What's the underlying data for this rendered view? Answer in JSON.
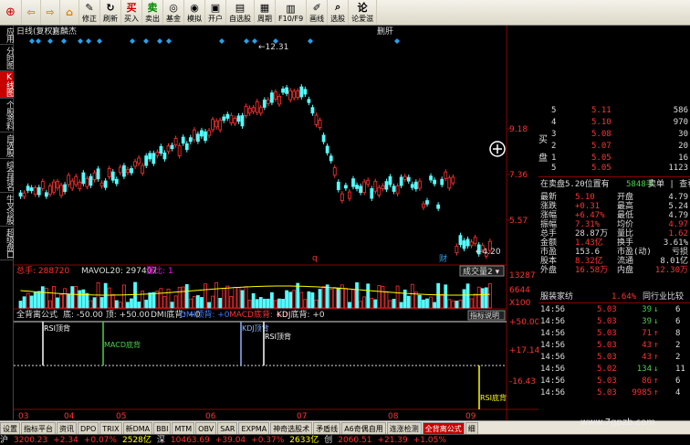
{
  "toolbar": [
    {
      "label": "",
      "icon": "back-icon"
    },
    {
      "label": "",
      "icon": "forward-icon"
    },
    {
      "label": "",
      "icon": "home-icon"
    },
    {
      "label": "修正",
      "icon": "edit-icon"
    },
    {
      "label": "刷新",
      "icon": "refresh-icon"
    },
    {
      "label": "买入",
      "icon": "buy-icon"
    },
    {
      "label": "卖出",
      "icon": "sell-icon"
    },
    {
      "label": "基金",
      "icon": "fund-icon"
    },
    {
      "label": "模拟",
      "icon": "simulate-icon"
    },
    {
      "label": "开户",
      "icon": "account-icon"
    },
    {
      "label": "自选股",
      "icon": "watchlist-icon"
    },
    {
      "label": "周期",
      "icon": "period-icon"
    },
    {
      "label": "F10/F9",
      "icon": "f10-icon"
    },
    {
      "label": "画线",
      "icon": "draw-icon"
    },
    {
      "label": "选股",
      "icon": "stock-pick-icon"
    },
    {
      "label": "论爱滋",
      "icon": "forum-icon"
    }
  ],
  "side_tabs": [
    "应用",
    "分时图",
    "K线图",
    "个股资料",
    "自选股",
    "综合排名",
    "牛叉诊股",
    "超级盘口"
  ],
  "chart": {
    "header": "日线(复权)",
    "stock_name": "嘉麟杰",
    "header_right": "删肝",
    "price_ticks": [
      "9.18",
      "7.36",
      "5.57"
    ],
    "max_label": "12.31",
    "min_label": "4.20",
    "vol_header": "总手: 288720",
    "mavol": "MAVOL20: 297407",
    "vol_ratio": "量比: 1",
    "vol_select": "成交量2",
    "vol_ticks": [
      "13287",
      "6644",
      "X100"
    ],
    "ind_header": "全背离公式",
    "ind_params": "底: -50.00  顶: +50.00",
    "ind_items": [
      "DMI底背: +0",
      "DMI顶背: +0",
      "MACD底背: +0",
      "KDJ底背: +0"
    ],
    "ind_help": "指标说明",
    "ind_ticks": [
      "+50.00",
      "+17.14",
      "-16.43"
    ],
    "signals": [
      "RSI顶背",
      "MACD底背",
      "KDJ顶背",
      "RSI顶背",
      "RSI底背"
    ],
    "months": [
      "03",
      "04",
      "05",
      "06",
      "07",
      "08",
      "09"
    ],
    "marker_q": "q",
    "marker_cai": "财"
  },
  "quote": {
    "sell": [
      {
        "label": "5",
        "price": "5.11",
        "vol": "586"
      },
      {
        "label": "4",
        "price": "5.10",
        "vol": "970"
      },
      {
        "label": "3",
        "price": "5.08",
        "vol": "30"
      },
      {
        "label": "2",
        "price": "5.07",
        "vol": "20"
      },
      {
        "label": "1",
        "price": "5.05",
        "vol": "16"
      }
    ],
    "buy_first": {
      "label": "5",
      "price": "5.05",
      "vol": "1123"
    },
    "sell_side_label": "买",
    "buy_side_label": "盘",
    "info_line": "在卖盘5.20位置有",
    "info_qty": "5848手",
    "info_link": "卖单 | 查看详细",
    "stats": [
      [
        "最新",
        "5.10",
        "开盘",
        "4.79"
      ],
      [
        "涨跌",
        "+0.31",
        "最高",
        "5.24"
      ],
      [
        "涨幅",
        "+6.47%",
        "最低",
        "4.79"
      ],
      [
        "振幅",
        "7.31%",
        "均价",
        "4.97"
      ],
      [
        "总手",
        "28.87万",
        "量比",
        "1.62"
      ],
      [
        "金额",
        "1.43亿",
        "换手",
        "3.61%"
      ],
      [
        "市盈",
        "153.6",
        "市盈(动)",
        "亏损"
      ],
      [
        "股本",
        "8.32亿",
        "流通",
        "8.01亿"
      ],
      [
        "外盘",
        "16.58万",
        "内盘",
        "12.30万"
      ]
    ],
    "industry": "服装家纺",
    "industry_pct": "1.64%",
    "industry_link": "同行业比较",
    "ticks": [
      {
        "time": "14:56",
        "price": "5.03",
        "vol": "39",
        "dir": "down",
        "n": "6"
      },
      {
        "time": "14:56",
        "price": "5.03",
        "vol": "39",
        "dir": "down",
        "n": "6"
      },
      {
        "time": "14:56",
        "price": "5.03",
        "vol": "71",
        "dir": "up",
        "n": "8"
      },
      {
        "time": "14:56",
        "price": "5.03",
        "vol": "43",
        "dir": "up",
        "n": "2"
      },
      {
        "time": "14:56",
        "price": "5.03",
        "vol": "43",
        "dir": "up",
        "n": "2"
      },
      {
        "time": "14:56",
        "price": "5.02",
        "vol": "134",
        "dir": "down",
        "n": "11"
      },
      {
        "time": "14:56",
        "price": "5.03",
        "vol": "86",
        "dir": "up",
        "n": "6"
      },
      {
        "time": "14:56",
        "price": "5.03",
        "vol": "9985",
        "dir": "up",
        "n": "4"
      }
    ]
  },
  "bottom_tabs": [
    "设置",
    "指标平台",
    "资讯",
    "DPO",
    "TRIX",
    "新DMA",
    "BBI",
    "MTM",
    "OBV",
    "SAR",
    "EXPMA",
    "神奇选股术",
    "矛盾线",
    "A6奇偶自用",
    "连涨检测",
    "全背离公式",
    "细"
  ],
  "status": [
    "沪",
    "3200.23",
    "+2.34",
    "+0.07%",
    "2528亿",
    "深",
    "10463.69",
    "+39.04",
    "+0.37%",
    "2633亿",
    "创",
    "2060.51",
    "+21.39",
    "+1.05%"
  ],
  "watermark": "www.7gpzb.com",
  "colors": {
    "up": "#ff3232",
    "down": "#54fcfc",
    "label": "#ff3232",
    "yellow": "#ffff00",
    "grid": "#8b0000",
    "accent": "#c80000"
  }
}
